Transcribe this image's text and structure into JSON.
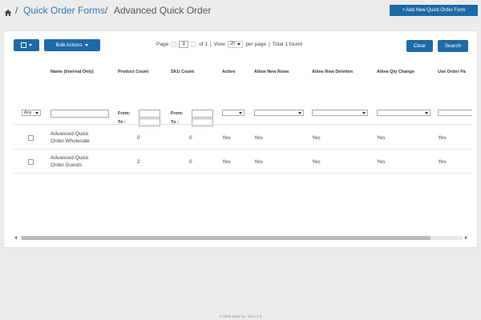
{
  "breadcrumb": {
    "link": "Quick Order Forms",
    "separator": "/",
    "current": "Advanced Quick Order"
  },
  "header": {
    "add_button": "+ Add New Quick Order Form"
  },
  "toolbar": {
    "bulk_actions": "Bulk Actions",
    "page_label": "Page",
    "page_value": "1",
    "of_label": "of 1",
    "divider": "|",
    "view_label": "View",
    "per_page_value": "20",
    "per_page_label": "per page",
    "total_found": "Total 1 found",
    "clear": "Clear",
    "search": "Search"
  },
  "columns": [
    "Name (Internal Only)",
    "Product Count",
    "SKU Count",
    "Active",
    "Allow New Rows",
    "Allow Row Deletion",
    "Allow Qty Change",
    "Use Order Pa"
  ],
  "filters": {
    "any_select": "Any",
    "from_label": "From:",
    "to_label": "To :"
  },
  "rows": [
    {
      "name_line1": "Advanced Quick",
      "name_line2": "Order Wholesale",
      "product_count": "0",
      "sku_count": "0",
      "active": "Yes",
      "allow_new_rows": "Yes",
      "allow_row_deletion": "Yes",
      "allow_qty_change": "Yes",
      "use_order": "Yes"
    },
    {
      "name_line1": "Advanced Quick",
      "name_line2": "Order Guests",
      "product_count": "2",
      "sku_count": "0",
      "active": "Yes",
      "allow_new_rows": "Yes",
      "allow_row_deletion": "Yes",
      "allow_qty_change": "Yes",
      "use_order": "Yes"
    }
  ],
  "footer": "© 2016 Zoey Inc. V2.1.7-5",
  "colors": {
    "primary": "#1e6aa7",
    "link": "#2a7ab7",
    "background": "#ececec"
  }
}
